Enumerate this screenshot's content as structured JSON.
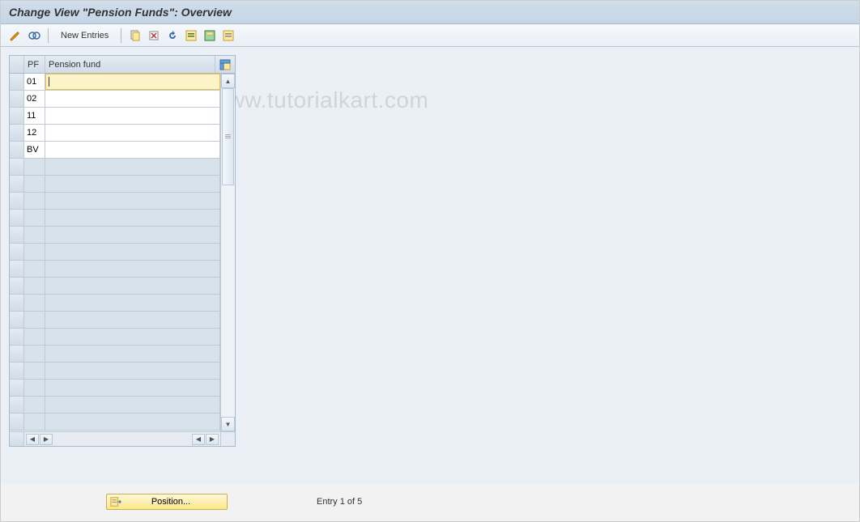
{
  "title": "Change View \"Pension Funds\": Overview",
  "toolbar": {
    "new_entries_label": "New Entries"
  },
  "table": {
    "headers": {
      "pf": "PF",
      "pension_fund": "Pension fund"
    },
    "rows": [
      {
        "pf": "01",
        "name": "",
        "focused": true
      },
      {
        "pf": "02",
        "name": ""
      },
      {
        "pf": "11",
        "name": ""
      },
      {
        "pf": "12",
        "name": ""
      },
      {
        "pf": "BV",
        "name": ""
      }
    ],
    "empty_row_count": 16
  },
  "footer": {
    "position_label": "Position...",
    "entry_info": "Entry 1 of 5"
  },
  "watermark": "www.tutorialkart.com"
}
